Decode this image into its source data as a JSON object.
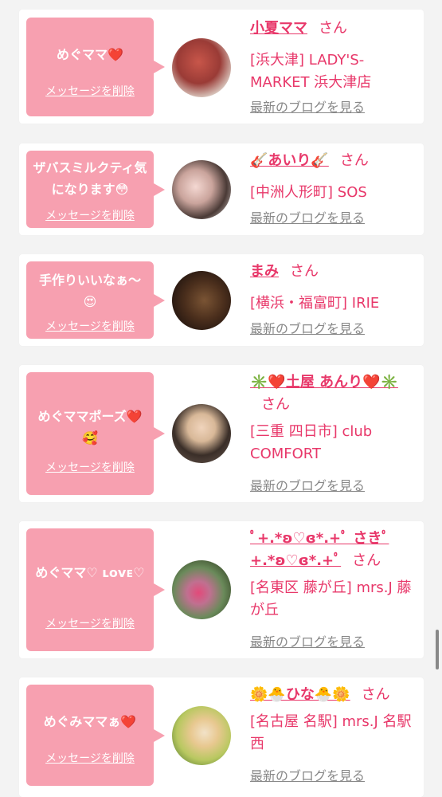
{
  "actions": {
    "delete_label": "メッセージを削除",
    "blog_label": "最新のブログを見る",
    "honorific": "さん"
  },
  "colors": {
    "bubble": "#f7a0b0",
    "accent": "#e8386a",
    "link_gray": "#888888",
    "background": "#f3f3f3"
  },
  "messages": [
    {
      "message": "めぐママ❤️",
      "name": "小夏ママ",
      "shop": "[浜大津] LADY'S-MARKET 浜大津店"
    },
    {
      "message": "ザバスミルクティ気になります😳",
      "name": "🎸あいり🎸",
      "shop": "[中洲人形町] SOS"
    },
    {
      "message": "手作りいいなぁ〜😍",
      "name": "まみ",
      "shop": "[横浜・福富町] IRIE"
    },
    {
      "message": "めぐママポーズ❤️🥰",
      "name": "✳️❤️土屋 あんり❤️✳️",
      "shop": "[三重 四日市] club COMFORT"
    },
    {
      "message": "めぐママ♡ ʟᴏᴠᴇ♡",
      "name": "ﾟ+.*ʚ♡ɞ*.+ﾟ さきﾟ+.*ʚ♡ɞ*.+ﾟ",
      "shop": "[名東区 藤が丘] mrs.J 藤が丘"
    },
    {
      "message": "めぐみママぁ❤️",
      "name": "🌼🐣ひな🐣🌼",
      "shop": "[名古屋 名駅] mrs.J 名駅西"
    }
  ]
}
